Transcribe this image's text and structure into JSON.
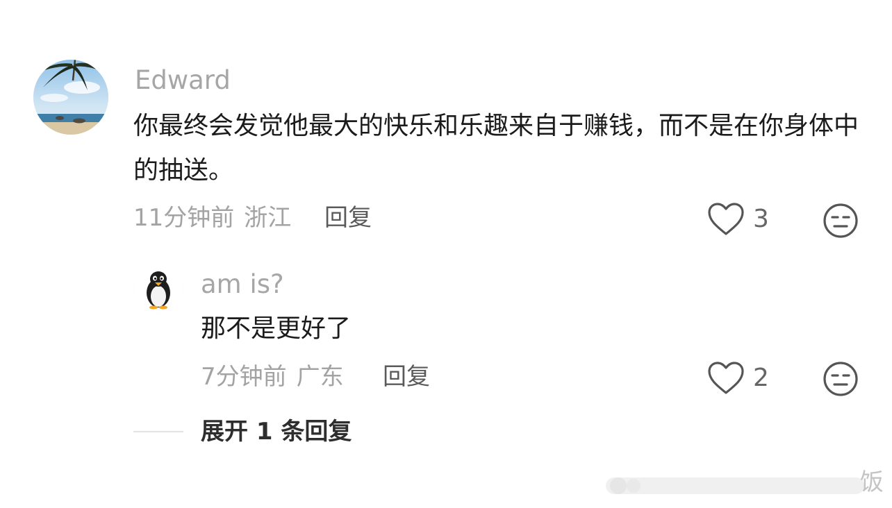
{
  "comments": [
    {
      "username": "Edward",
      "text": "你最终会发觉他最大的快乐和乐趣来自于赚钱，而不是在你身体中的抽送。",
      "time": "11分钟前",
      "location": "浙江",
      "reply_label": "回复",
      "likes": "3",
      "avatar_icon": "beach-palm-avatar",
      "like_icon": "heart-outline-icon",
      "reaction_icon": "meh-face-icon"
    },
    {
      "username": "am is?",
      "text": "那不是更好了",
      "time": "7分钟前",
      "location": "广东",
      "reply_label": "回复",
      "likes": "2",
      "avatar_icon": "penguin-avatar",
      "like_icon": "heart-outline-icon",
      "reaction_icon": "meh-face-icon"
    }
  ],
  "expand_replies_label": "展开 1 条回复",
  "watermark_char": "饭",
  "colors": {
    "username": "#a6a6a6",
    "text": "#1b1b1b",
    "meta": "#a3a3a3",
    "reply": "#5a5a5a",
    "icon": "#555555"
  }
}
